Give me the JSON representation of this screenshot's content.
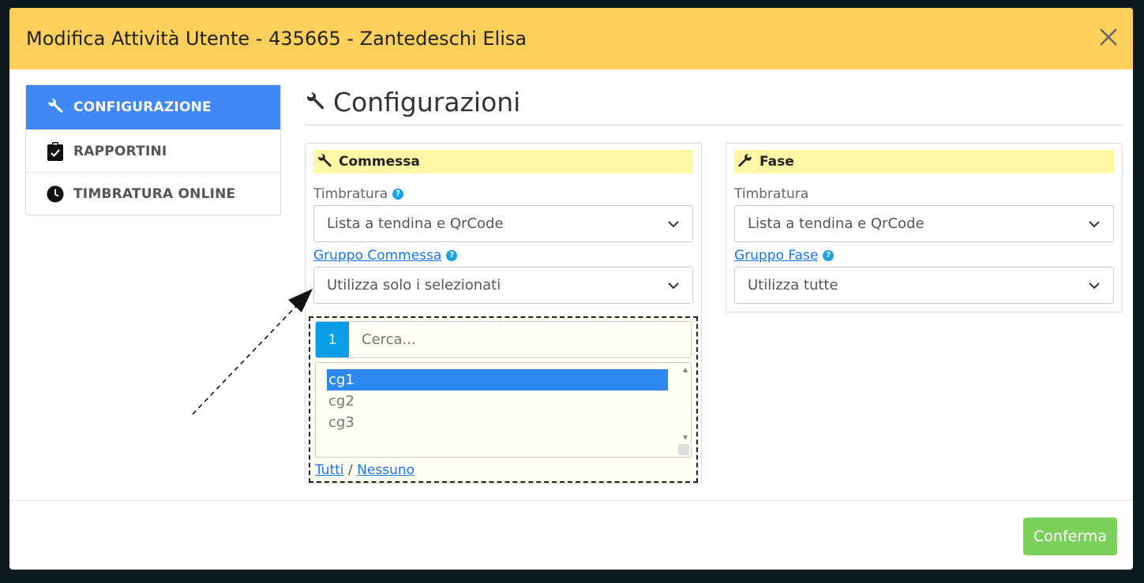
{
  "modal": {
    "title": "Modifica Attività Utente - 435665 - Zantedeschi Elisa",
    "close_icon": "close-icon",
    "header_color": "#fcd05a"
  },
  "sidebar": {
    "items": [
      {
        "label": "CONFIGURAZIONE",
        "icon": "wrench-icon",
        "active": true
      },
      {
        "label": "RAPPORTINI",
        "icon": "clipboard-check-icon",
        "active": false
      },
      {
        "label": "TIMBRATURA ONLINE",
        "icon": "clock-icon",
        "active": false
      }
    ],
    "active_color": "#3f87f5"
  },
  "main": {
    "heading": "Configurazioni",
    "commessa": {
      "title": "Commessa",
      "timbratura_label": "Timbratura",
      "timbratura_value": "Lista a tendina e QrCode",
      "gruppo_label": "Gruppo Commessa",
      "gruppo_value": "Utilizza solo i selezionati",
      "picker": {
        "count": "1",
        "search_placeholder": "Cerca...",
        "options": [
          "cg1",
          "cg2",
          "cg3"
        ],
        "selected": "cg1",
        "all_link": "Tutti",
        "separator": "/",
        "none_link": "Nessuno"
      }
    },
    "fase": {
      "title": "Fase",
      "timbratura_label": "Timbratura",
      "timbratura_value": "Lista a tendina e QrCode",
      "gruppo_label": "Gruppo Fase",
      "gruppo_value": "Utilizza tutte"
    }
  },
  "footer": {
    "confirm_label": "Conferma",
    "confirm_color": "#7ccf5a"
  }
}
